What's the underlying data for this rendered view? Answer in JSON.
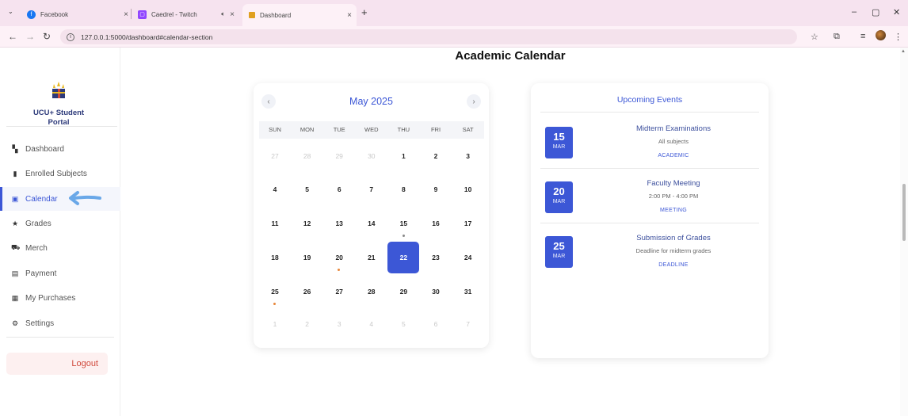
{
  "browser": {
    "tabs": [
      {
        "title": "Facebook",
        "icon": "facebook-icon",
        "color": "#1877f2"
      },
      {
        "title": "Caedrel - Twitch",
        "icon": "twitch-icon",
        "color": "#9146ff"
      },
      {
        "title": "Dashboard",
        "icon": "dashboard-favicon",
        "color": "#e0a020"
      }
    ],
    "url": "127.0.0.1:5000/dashboard#calendar-section"
  },
  "sidebar": {
    "brand": "UCU+ Student Portal",
    "items": [
      {
        "label": "Dashboard",
        "icon": "grid-icon",
        "active": false
      },
      {
        "label": "Enrolled Subjects",
        "icon": "book-icon",
        "active": false
      },
      {
        "label": "Calendar",
        "icon": "calendar-icon",
        "active": true
      },
      {
        "label": "Grades",
        "icon": "star-icon",
        "active": false
      },
      {
        "label": "Merch",
        "icon": "cart-icon",
        "active": false
      },
      {
        "label": "Payment",
        "icon": "card-icon",
        "active": false
      },
      {
        "label": "My Purchases",
        "icon": "receipt-icon",
        "active": false
      },
      {
        "label": "Settings",
        "icon": "gear-icon",
        "active": false
      }
    ],
    "logout": "Logout"
  },
  "page": {
    "title": "Academic Calendar"
  },
  "calendar": {
    "month": "May 2025",
    "weekdays": [
      "SUN",
      "MON",
      "TUE",
      "WED",
      "THU",
      "FRI",
      "SAT"
    ],
    "weeks": [
      [
        "27",
        "28",
        "29",
        "30",
        "1",
        "2",
        "3"
      ],
      [
        "4",
        "5",
        "6",
        "7",
        "8",
        "9",
        "10"
      ],
      [
        "11",
        "12",
        "13",
        "14",
        "15",
        "16",
        "17"
      ],
      [
        "18",
        "19",
        "20",
        "21",
        "22",
        "23",
        "24"
      ],
      [
        "25",
        "26",
        "27",
        "28",
        "29",
        "30",
        "31"
      ],
      [
        "1",
        "2",
        "3",
        "4",
        "5",
        "6",
        "7"
      ]
    ],
    "selected": "22",
    "accent": "#3c57d6"
  },
  "events": {
    "title": "Upcoming Events",
    "items": [
      {
        "day": "15",
        "month": "MAR",
        "name": "Midterm Examinations",
        "sub": "All subjects",
        "tag": "ACADEMIC"
      },
      {
        "day": "20",
        "month": "MAR",
        "name": "Faculty Meeting",
        "sub": "2:00 PM - 4:00 PM",
        "tag": "MEETING"
      },
      {
        "day": "25",
        "month": "MAR",
        "name": "Submission of Grades",
        "sub": "Deadline for midterm grades",
        "tag": "DEADLINE"
      }
    ]
  }
}
